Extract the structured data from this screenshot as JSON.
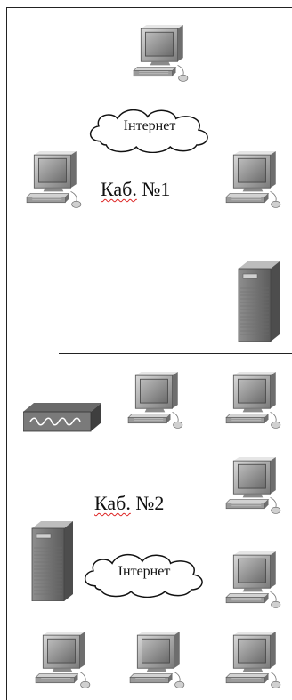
{
  "room1": {
    "label_prefix": "Каб.",
    "label_number": "№1",
    "cloud_label": "Інтернет"
  },
  "room2": {
    "label_prefix": "Каб.",
    "label_number": "№2",
    "cloud_label": "Інтернет"
  },
  "icons": {
    "computer": "computer-icon",
    "server": "server-icon",
    "switch": "network-switch-icon",
    "cloud": "internet-cloud-icon"
  }
}
